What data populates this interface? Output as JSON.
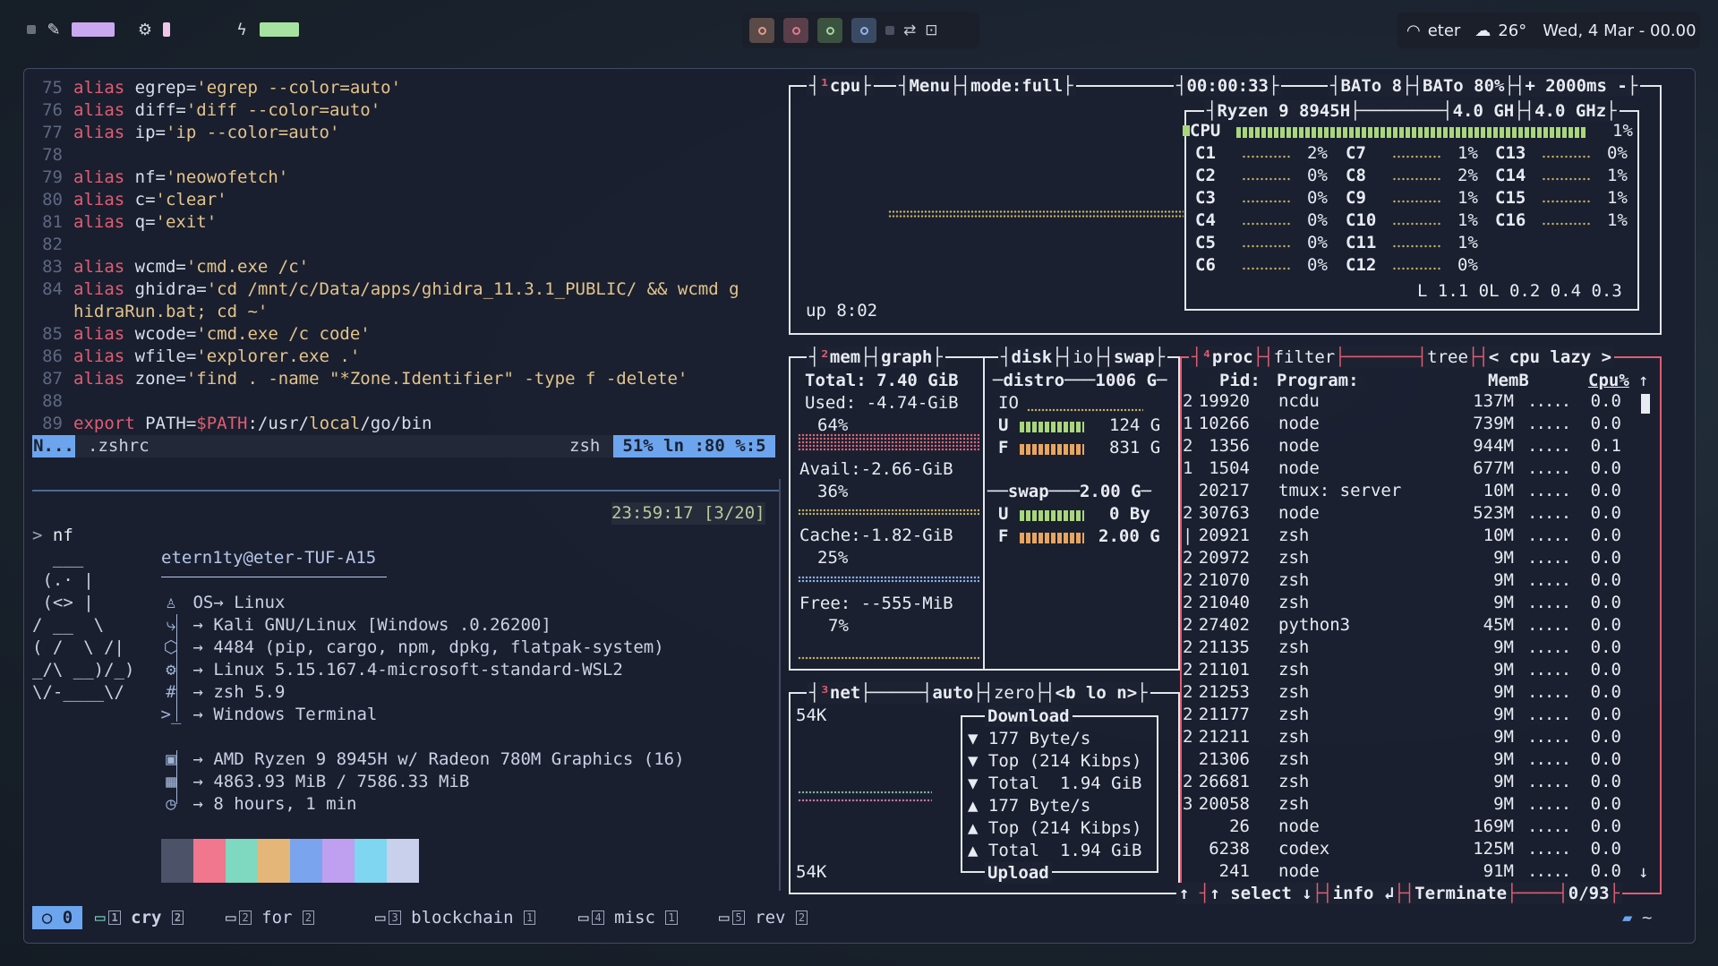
{
  "topbar": {
    "left_icons": [
      "pencil-icon",
      "cpu-icon",
      "bolt-icon"
    ],
    "left_bar_colors": [
      "#c9a8f0",
      "#f0c6e8",
      "#a6e3a1"
    ],
    "workspaces": [
      {
        "color": "#e09a8a",
        "bg": "#5a4a48"
      },
      {
        "color": "#e07a8f",
        "bg": "#5a3e4a"
      },
      {
        "color": "#9fd89a",
        "bg": "#3c5240"
      },
      {
        "color": "#8fb4ef",
        "bg": "#3a4a63"
      }
    ],
    "wifi_label": "eter",
    "weather": "26°",
    "datetime": "Wed, 4 Mar - 00.00"
  },
  "editor": {
    "lines": [
      {
        "n": "75",
        "cmd": "alias",
        "rest": " egrep=",
        "str": "'egrep --color=auto'"
      },
      {
        "n": "76",
        "cmd": "alias",
        "rest": " diff=",
        "str": "'diff --color=auto'"
      },
      {
        "n": "77",
        "cmd": "alias",
        "rest": " ip=",
        "str": "'ip --color=auto'"
      },
      {
        "n": "78",
        "cmd": "",
        "rest": "",
        "str": ""
      },
      {
        "n": "79",
        "cmd": "alias",
        "rest": " nf=",
        "str": "'neowofetch'"
      },
      {
        "n": "80",
        "cmd": "alias",
        "rest": " c=",
        "str": "'clear'"
      },
      {
        "n": "81",
        "cmd": "alias",
        "rest": " q=",
        "str": "'exit'"
      },
      {
        "n": "82",
        "cmd": "",
        "rest": "",
        "str": ""
      },
      {
        "n": "83",
        "cmd": "alias",
        "rest": " wcmd=",
        "str": "'cmd.exe /c'"
      },
      {
        "n": "84",
        "cmd": "alias",
        "rest": " ghidra=",
        "str": "'cd /mnt/c/Data/apps/ghidra_11.3.1_PUBLIC/ && wcmd g"
      },
      {
        "n": "",
        "cmd": "",
        "rest": "",
        "str": "hidraRun.bat; cd ~'"
      },
      {
        "n": "85",
        "cmd": "alias",
        "rest": " wcode=",
        "str": "'cmd.exe /c code'"
      },
      {
        "n": "86",
        "cmd": "alias",
        "rest": " wfile=",
        "str": "'explorer.exe .'"
      },
      {
        "n": "87",
        "cmd": "alias",
        "rest": " zone=",
        "str": "'find . -name \"*Zone.Identifier\" -type f -delete'"
      },
      {
        "n": "88",
        "cmd": "",
        "rest": "",
        "str": ""
      },
      {
        "n": "89",
        "cmd": "export",
        "rest": " PATH=",
        "str": ""
      }
    ],
    "export_value": {
      "var": "$PATH",
      "p1": ":/usr/",
      "p2": "local",
      "p3": "/go/bin"
    },
    "status": {
      "mode": "N...",
      "file": ".zshrc",
      "shell": "zsh",
      "position": "51%  ln :80  %:5"
    }
  },
  "terminal": {
    "clock": "23:59:17 [3/20]",
    "prompt": ">",
    "command": "nf",
    "user_host": "etern1ty@eter-TUF-A15",
    "ascii": [
      "  ___",
      " (.· |",
      " (<> |",
      "/ __  \\",
      "( /  \\ /|",
      "_/\\ __)/_)",
      "\\/-____\\/"
    ],
    "info": [
      {
        "icon": "linux-icon",
        "glyph": "♙",
        "text": "OS→ Linux"
      },
      {
        "icon": "distro-icon",
        "glyph": "⤷",
        "text": "→ Kali GNU/Linux [Windows .0.26200]"
      },
      {
        "icon": "package-icon",
        "glyph": "⬡",
        "text": "→ 4484 (pip, cargo, npm, dpkg, flatpak-system)"
      },
      {
        "icon": "kernel-icon",
        "glyph": "⚙",
        "text": "→ Linux 5.15.167.4-microsoft-standard-WSL2"
      },
      {
        "icon": "shell-icon",
        "glyph": "#",
        "text": "→ zsh 5.9"
      },
      {
        "icon": "terminal-icon",
        "glyph": ">_",
        "text": "→ Windows Terminal"
      },
      {
        "icon": "cpu-chip-icon",
        "glyph": "▣",
        "text": "→ AMD Ryzen 9 8945H w/ Radeon 780M Graphics (16)"
      },
      {
        "icon": "memory-icon",
        "glyph": "▦",
        "text": "→ 4863.93 MiB / 7586.33 MiB"
      },
      {
        "icon": "clock-icon",
        "glyph": "◷",
        "text": "→ 8 hours, 1 min"
      }
    ],
    "palette": [
      "#4c5267",
      "#f0778e",
      "#7fd8c0",
      "#e4b778",
      "#7aa4ee",
      "#bfa0f0",
      "#7ed6f0",
      "#c8d0ec"
    ]
  },
  "btop": {
    "cpu": {
      "title_num": "¹",
      "title": "cpu",
      "menu": "Menu",
      "mode": "mode:full",
      "clock": "00:00:33",
      "bat1": "BATo 8",
      "bat2": "BATo 80%",
      "rate": "+ 2000ms -",
      "model": "Ryzen 9 8945H",
      "freq1": "4.0 GH",
      "freq2": "4.0 GHz",
      "total_label": "CPU",
      "total_pct": "1%",
      "cores": [
        [
          "C1",
          "2%"
        ],
        [
          "C2",
          "0%"
        ],
        [
          "C3",
          "0%"
        ],
        [
          "C4",
          "0%"
        ],
        [
          "C5",
          "0%"
        ],
        [
          "C6",
          "0%"
        ],
        [
          "C7",
          "1%"
        ],
        [
          "C8",
          "2%"
        ],
        [
          "C9",
          "1%"
        ],
        [
          "C10",
          "1%"
        ],
        [
          "C11",
          "1%"
        ],
        [
          "C12",
          "0%"
        ],
        [
          "C13",
          "0%"
        ],
        [
          "C14",
          "1%"
        ],
        [
          "C15",
          "1%"
        ],
        [
          "C16",
          "1%"
        ]
      ],
      "load": "L 1.1 0L 0.2 0.4 0.3",
      "uptime": "up 8:02"
    },
    "mem": {
      "title_num": "²",
      "title": "mem",
      "graph_label": "graph",
      "total": "Total: 7.40 GiB",
      "used": "Used: -4.74-GiB",
      "used_pct": "64%",
      "avail": "Avail:-2.66-GiB",
      "avail_pct": "36%",
      "cache": "Cache:-1.82-GiB",
      "cache_pct": "25%",
      "free": "Free: --555-MiB",
      "free_pct": "7%"
    },
    "disk": {
      "title": "disk",
      "io": "io",
      "swap": "swap",
      "distro": "distro",
      "size": "1006 G",
      "io_label": "IO",
      "u_label": "U",
      "u_val": "124 G",
      "f_label": "F",
      "f_val": "831 G",
      "swap_label": "swap",
      "swap_size": "2.00 G",
      "su_val": "0 By",
      "sf_val": "2.00 G"
    },
    "net": {
      "title_num": "³",
      "title": "net",
      "auto": "auto",
      "zero": "zero",
      "iface": "<b lo n>",
      "scale_top": "54K",
      "scale_bottom": "54K",
      "download": "Download",
      "dl_rate": "▼ 177 Byte/s",
      "dl_top": "▼ Top (214 Kibps)",
      "dl_total": "▼ Total  1.94 GiB",
      "ul_rate": "▲ 177 Byte/s",
      "ul_top": "▲ Top (214 Kibps)",
      "ul_total": "▲ Total  1.94 GiB",
      "upload": "Upload"
    },
    "proc": {
      "title_num": "⁴",
      "title": "proc",
      "filter": "filter",
      "tree": "tree",
      "sort": "< cpu lazy >",
      "headers": {
        "pid": "Pid:",
        "program": "Program:",
        "mem": "MemB",
        "cpu": "Cpu%"
      },
      "rows": [
        [
          "2",
          "19920",
          "ncdu",
          "137M",
          "0.0"
        ],
        [
          "1",
          "10266",
          "node",
          "739M",
          "0.0"
        ],
        [
          "2",
          "1356",
          "node",
          "944M",
          "0.1"
        ],
        [
          "1",
          "1504",
          "node",
          "677M",
          "0.0"
        ],
        [
          "",
          "20217",
          "tmux: server",
          "10M",
          "0.0"
        ],
        [
          "2",
          "30763",
          "node",
          "523M",
          "0.0"
        ],
        [
          "|",
          "20921",
          "zsh",
          "10M",
          "0.0"
        ],
        [
          "2",
          "20972",
          "zsh",
          "9M",
          "0.0"
        ],
        [
          "2",
          "21070",
          "zsh",
          "9M",
          "0.0"
        ],
        [
          "2",
          "21040",
          "zsh",
          "9M",
          "0.0"
        ],
        [
          "2",
          "27402",
          "python3",
          "45M",
          "0.0"
        ],
        [
          "2",
          "21135",
          "zsh",
          "9M",
          "0.0"
        ],
        [
          "2",
          "21101",
          "zsh",
          "9M",
          "0.0"
        ],
        [
          "2",
          "21253",
          "zsh",
          "9M",
          "0.0"
        ],
        [
          "2",
          "21177",
          "zsh",
          "9M",
          "0.0"
        ],
        [
          "2",
          "21211",
          "zsh",
          "9M",
          "0.0"
        ],
        [
          "",
          "21306",
          "zsh",
          "9M",
          "0.0"
        ],
        [
          "2",
          "26681",
          "zsh",
          "9M",
          "0.0"
        ],
        [
          "3",
          "20058",
          "zsh",
          "9M",
          "0.0"
        ],
        [
          "",
          "26",
          "node",
          "169M",
          "0.0"
        ],
        [
          "",
          "6238",
          "codex",
          "125M",
          "0.0"
        ],
        [
          "",
          "241",
          "node",
          "91M",
          "0.0"
        ]
      ],
      "footer_select": "↑ select ↓",
      "footer_info": "info ↲",
      "footer_terminate": "Terminate",
      "count": "0/93"
    }
  },
  "tmux": {
    "session": "0",
    "windows": [
      {
        "idx": "1",
        "name": "cry",
        "panes": "2",
        "active": true
      },
      {
        "idx": "2",
        "name": "for",
        "panes": "2",
        "active": false
      },
      {
        "idx": "3",
        "name": "blockchain",
        "panes": "1",
        "active": false
      },
      {
        "idx": "4",
        "name": "misc",
        "panes": "1",
        "active": false
      },
      {
        "idx": "5",
        "name": "rev",
        "panes": "2",
        "active": false
      }
    ],
    "cwd": "~"
  }
}
